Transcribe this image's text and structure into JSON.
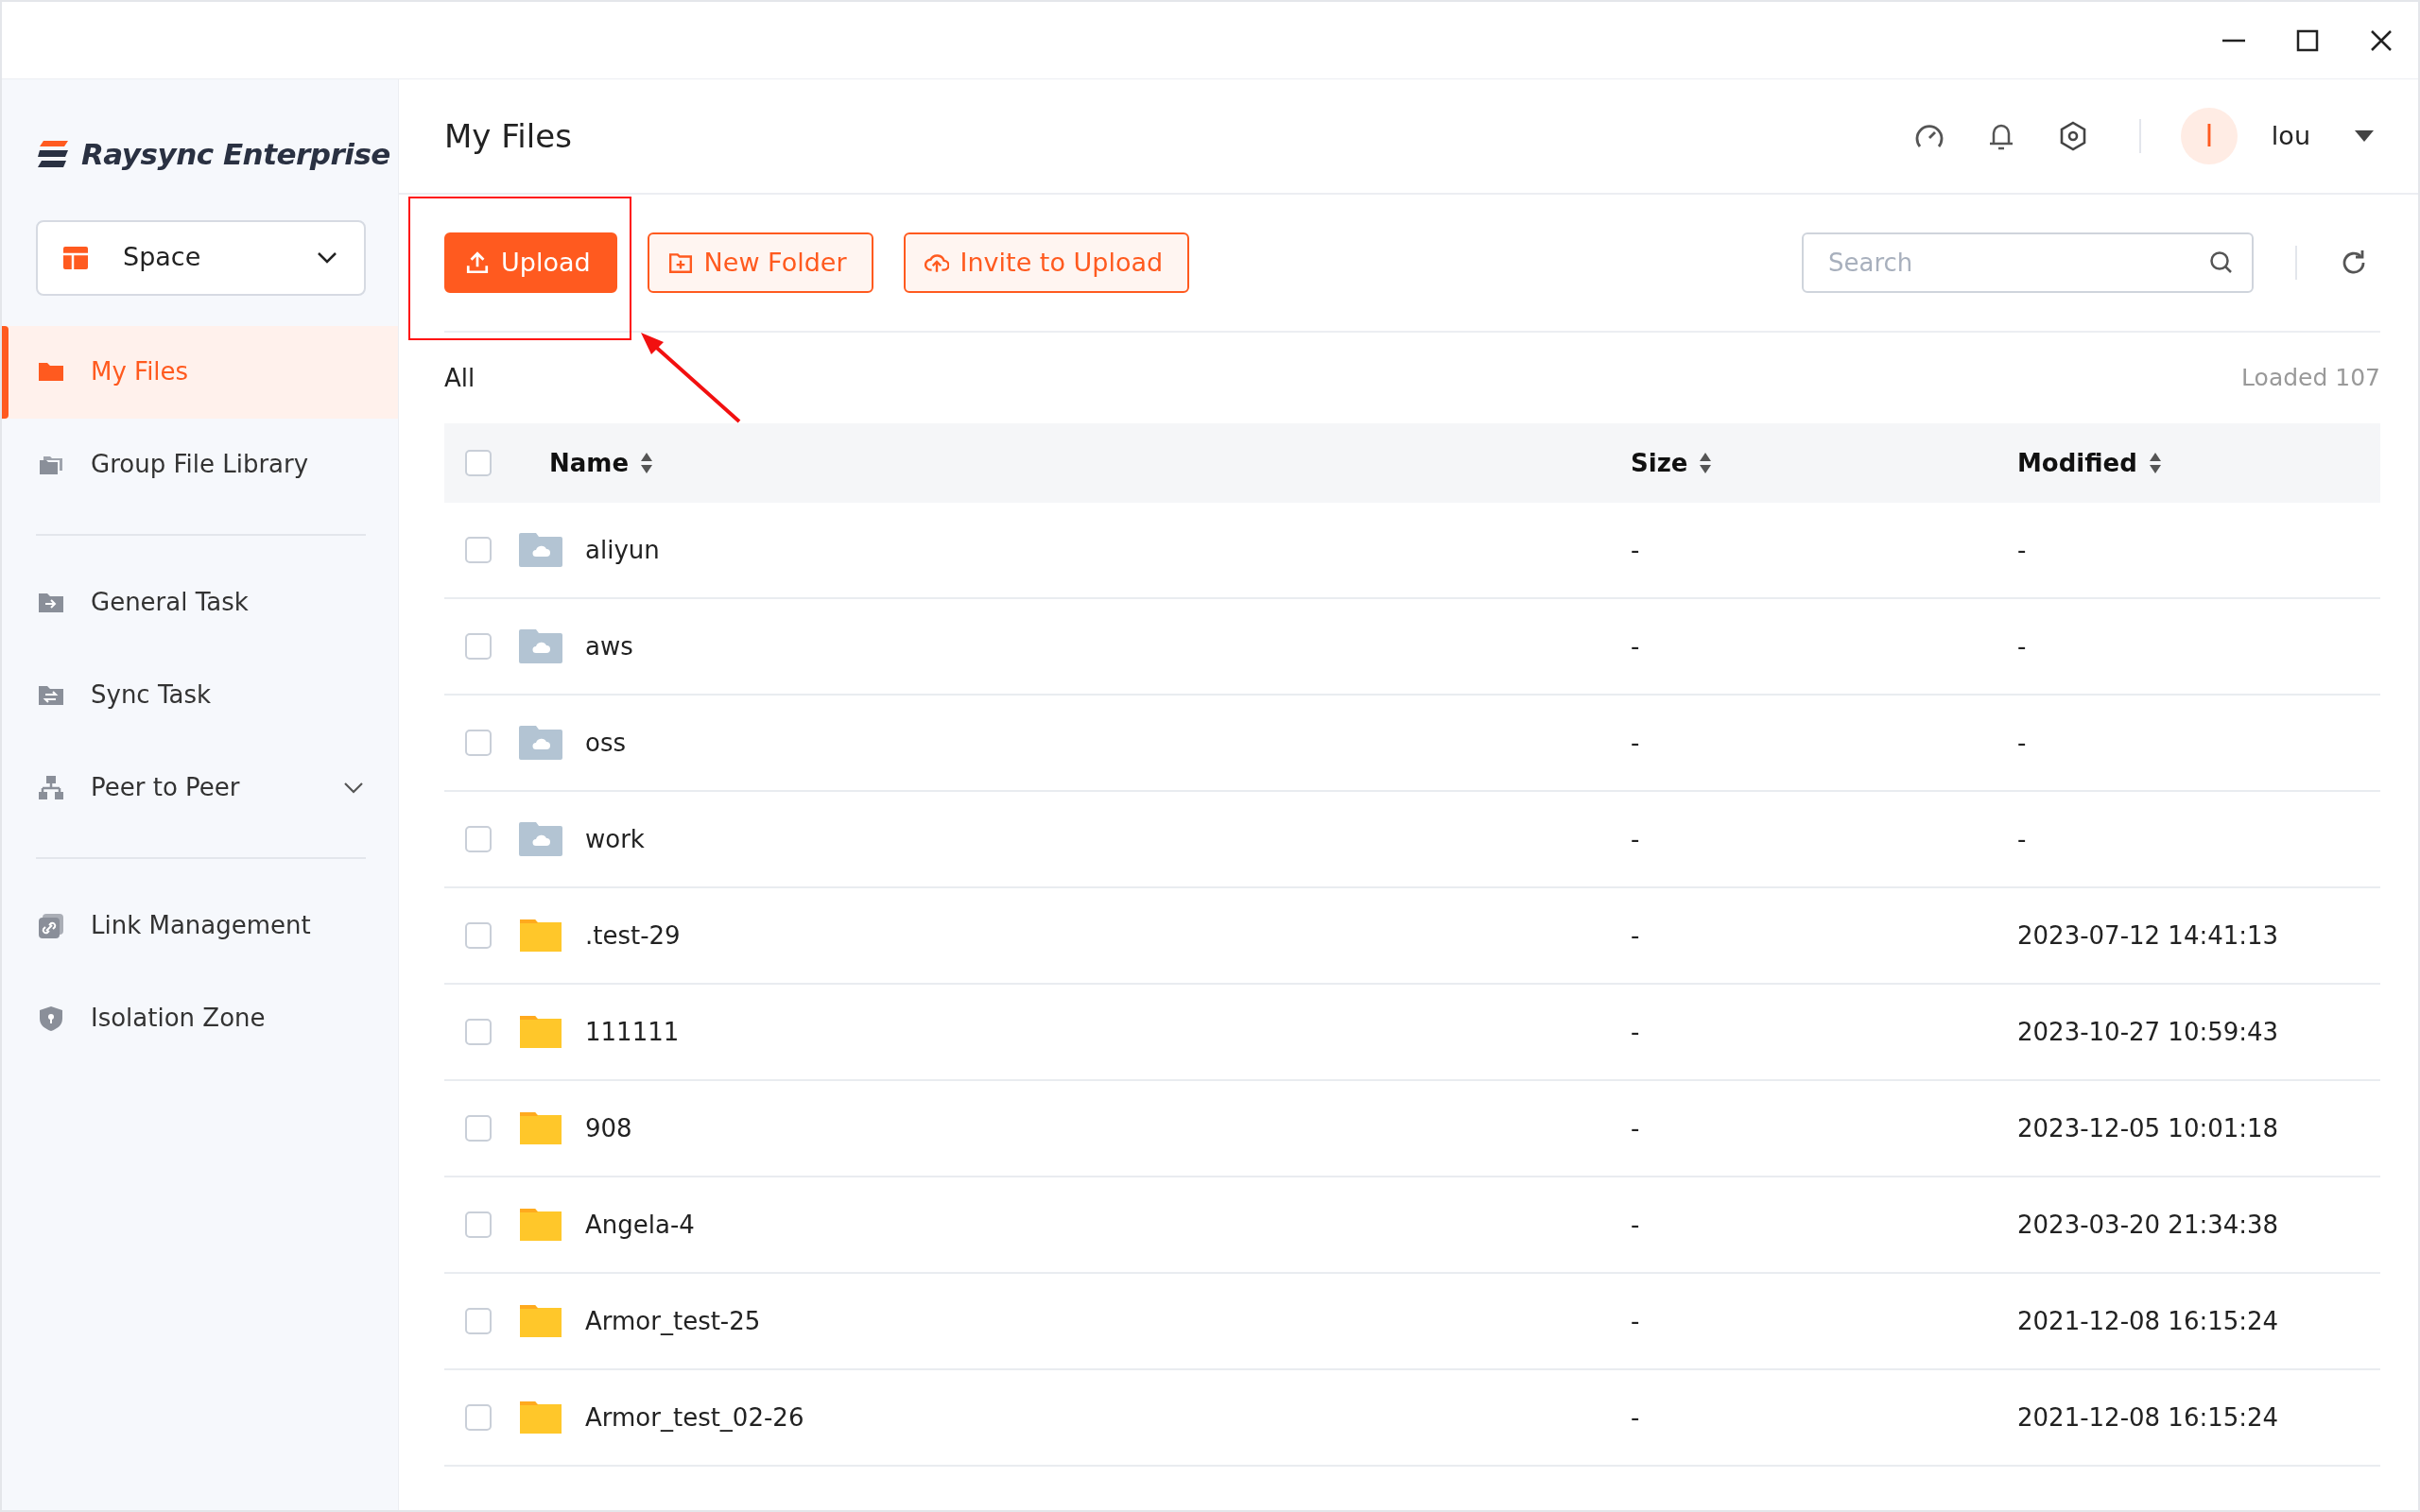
{
  "sidebar": {
    "logo": "Raysync Enterprise",
    "space_selector": {
      "label": "Space"
    },
    "groups": [
      [
        {
          "label": "My Files",
          "selected": true,
          "expandable": false
        },
        {
          "label": "Group File Library",
          "selected": false,
          "expandable": false
        }
      ],
      [
        {
          "label": "General Task",
          "selected": false,
          "expandable": false
        },
        {
          "label": "Sync Task",
          "selected": false,
          "expandable": false
        },
        {
          "label": "Peer to Peer",
          "selected": false,
          "expandable": true
        }
      ],
      [
        {
          "label": "Link Management",
          "selected": false,
          "expandable": false
        },
        {
          "label": "Isolation Zone",
          "selected": false,
          "expandable": false
        }
      ]
    ]
  },
  "header": {
    "title": "My Files",
    "user": {
      "initial": "l",
      "name": "lou"
    }
  },
  "toolbar": {
    "buttons": [
      {
        "label": "Upload",
        "kind": "primary"
      },
      {
        "label": "New Folder",
        "kind": "outline"
      },
      {
        "label": "Invite to Upload",
        "kind": "outline"
      }
    ],
    "search": {
      "placeholder": "Search"
    }
  },
  "breadcrumb": "All",
  "loaded": "Loaded 107",
  "table": {
    "select_all_checked": false,
    "columns": [
      "Name",
      "Size",
      "Modified"
    ],
    "rows": [
      {
        "kind": "cloud-folder",
        "name": "aliyun",
        "size": "-",
        "modified": "-",
        "checked": false
      },
      {
        "kind": "cloud-folder",
        "name": "aws",
        "size": "-",
        "modified": "-",
        "checked": false
      },
      {
        "kind": "cloud-folder",
        "name": "oss",
        "size": "-",
        "modified": "-",
        "checked": false
      },
      {
        "kind": "cloud-folder",
        "name": "work",
        "size": "-",
        "modified": "-",
        "checked": false
      },
      {
        "kind": "folder",
        "name": ".test-29",
        "size": "-",
        "modified": "2023-07-12 14:41:13",
        "checked": false
      },
      {
        "kind": "folder",
        "name": "111111",
        "size": "-",
        "modified": "2023-10-27 10:59:43",
        "checked": false
      },
      {
        "kind": "folder",
        "name": "908",
        "size": "-",
        "modified": "2023-12-05 10:01:18",
        "checked": false
      },
      {
        "kind": "folder",
        "name": "Angela-4",
        "size": "-",
        "modified": "2023-03-20 21:34:38",
        "checked": false
      },
      {
        "kind": "folder",
        "name": "Armor_test-25",
        "size": "-",
        "modified": "2021-12-08 16:15:24",
        "checked": false
      },
      {
        "kind": "folder",
        "name": "Armor_test_02-26",
        "size": "-",
        "modified": "2021-12-08 16:15:24",
        "checked": false
      }
    ]
  }
}
